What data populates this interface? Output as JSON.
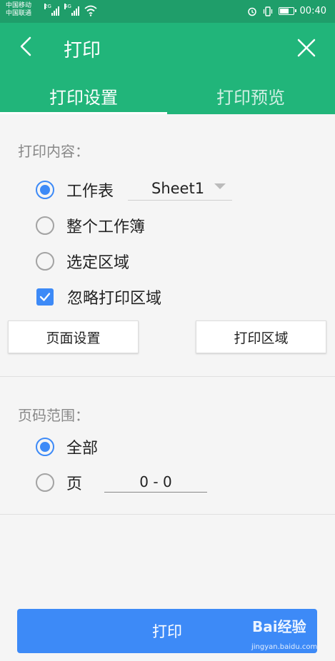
{
  "statusbar": {
    "carrier1": "中国移动",
    "carrier2": "中国联通",
    "net1": "2G",
    "net2": "4G",
    "time": "00:40",
    "battery_level": 0.75
  },
  "appbar": {
    "title": "打印",
    "tabs": [
      {
        "label": "打印设置",
        "active": true
      },
      {
        "label": "打印预览",
        "active": false
      }
    ]
  },
  "print_content": {
    "label": "打印内容：",
    "options": [
      {
        "label": "工作表",
        "selected": true
      },
      {
        "label": "整个工作簿",
        "selected": false
      },
      {
        "label": "选定区域",
        "selected": false
      }
    ],
    "sheet_value": "Sheet1",
    "ignore_area": {
      "label": "忽略打印区域",
      "checked": true
    }
  },
  "buttons": {
    "page_setup": "页面设置",
    "print_area": "打印区域"
  },
  "page_range": {
    "label": "页码范围：",
    "all": {
      "label": "全部",
      "selected": true
    },
    "pages": {
      "label": "页",
      "selected": false,
      "value": "0 - 0"
    }
  },
  "print_button": "打印",
  "watermark": {
    "logo": "Bai经验",
    "url": "jingyan.baidu.com"
  },
  "colors": {
    "primary": "#21b57a",
    "accent": "#3d8af7"
  }
}
